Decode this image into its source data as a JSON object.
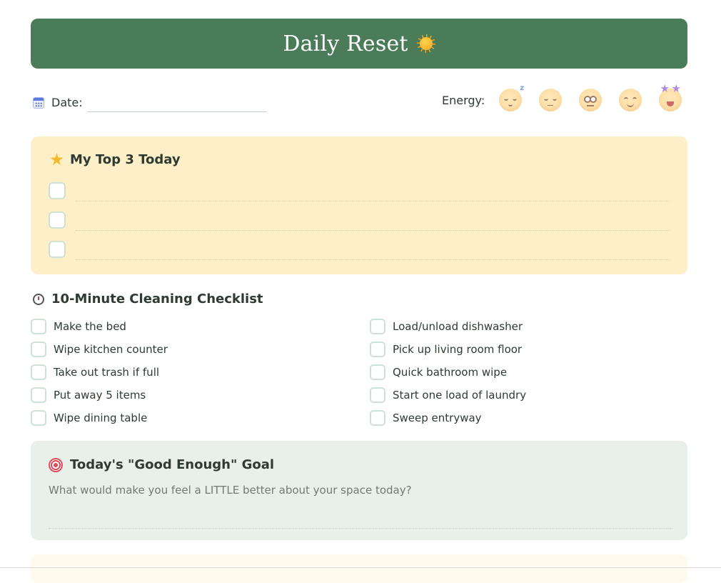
{
  "header": {
    "title": "Daily Reset",
    "icon": "sun-icon"
  },
  "date": {
    "label": "Date:",
    "value": "",
    "icon": "calendar-icon"
  },
  "energy": {
    "label": "Energy:",
    "options": [
      "sleepy-face-icon",
      "tired-face-icon",
      "neutral-face-icon",
      "smiling-face-icon",
      "star-struck-face-icon"
    ]
  },
  "top3": {
    "title": "My Top 3 Today",
    "icon": "star-icon",
    "items": [
      "",
      "",
      ""
    ]
  },
  "cleaning": {
    "title": "10-Minute Cleaning Checklist",
    "icon": "stopwatch-icon",
    "left_tasks": [
      "Make the bed",
      "Wipe kitchen counter",
      "Take out trash if full",
      "Put away 5 items",
      "Wipe dining table"
    ],
    "right_tasks": [
      "Load/unload dishwasher",
      "Pick up living room floor",
      "Quick bathroom wipe",
      "Start one load of laundry",
      "Sweep entryway"
    ]
  },
  "goal": {
    "title": "Today's \"Good Enough\" Goal",
    "icon": "target-icon",
    "prompt": "What would make you feel a LITTLE better about your space today?",
    "value": ""
  },
  "colors": {
    "header_bg": "#4a7c59",
    "top3_bg": "#fdf0c8",
    "goal_bg": "#e8f0e9",
    "checkbox_border": "#cfe0d4"
  }
}
